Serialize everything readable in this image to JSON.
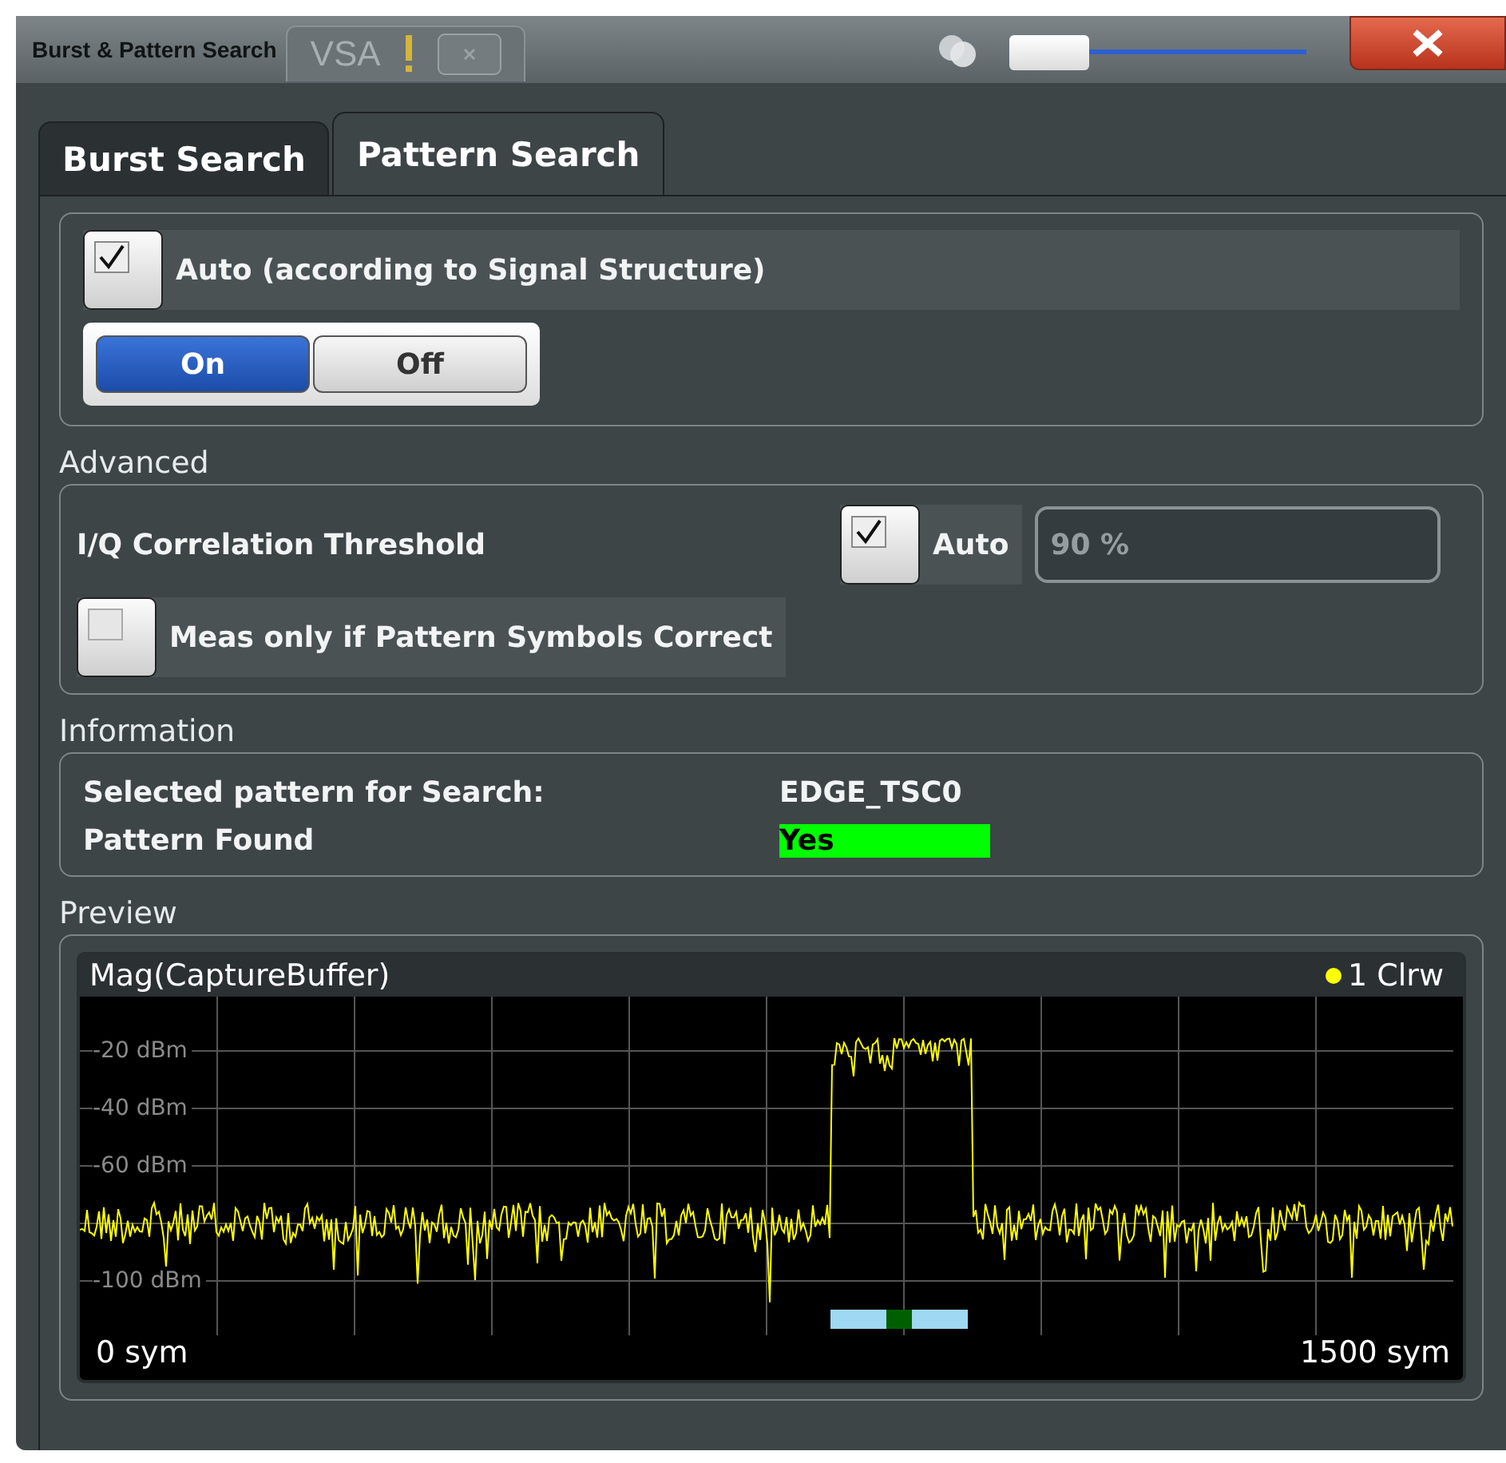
{
  "window": {
    "title": "Burst & Pattern Search",
    "background_tabs": [
      {
        "label": "VSA",
        "alert": true
      }
    ],
    "transparency": {
      "level": 0
    }
  },
  "tabs": [
    {
      "label": "Burst Search",
      "selected": false
    },
    {
      "label": "Pattern Search",
      "selected": true
    }
  ],
  "auto": {
    "label": "Auto (according to Signal Structure)",
    "checked": true,
    "toggle": [
      {
        "label": "On",
        "selected": true
      },
      {
        "label": "Off",
        "selected": false
      }
    ]
  },
  "advanced": {
    "title": "Advanced",
    "threshold": {
      "label": "I/Q Correlation Threshold",
      "auto_label": "Auto",
      "auto_checked": true,
      "value": "90 %",
      "disabled": true
    },
    "meas_only": {
      "label": "Meas only if Pattern Symbols Correct",
      "checked": false
    }
  },
  "information": {
    "title": "Information",
    "rows": [
      {
        "label": "Selected pattern for Search:",
        "value": "EDGE_TSC0",
        "highlight": false
      },
      {
        "label": "Pattern Found",
        "value": "Yes",
        "highlight": true
      }
    ]
  },
  "preview": {
    "title": "Preview",
    "chart": {
      "title": "Mag(CaptureBuffer)",
      "trace_label": "1 Clrw",
      "y_labels": [
        "-20 dBm",
        "-40 dBm",
        "-60 dBm",
        "-100 dBm"
      ],
      "x_start": "0 sym",
      "x_end": "1500 sym"
    }
  }
}
